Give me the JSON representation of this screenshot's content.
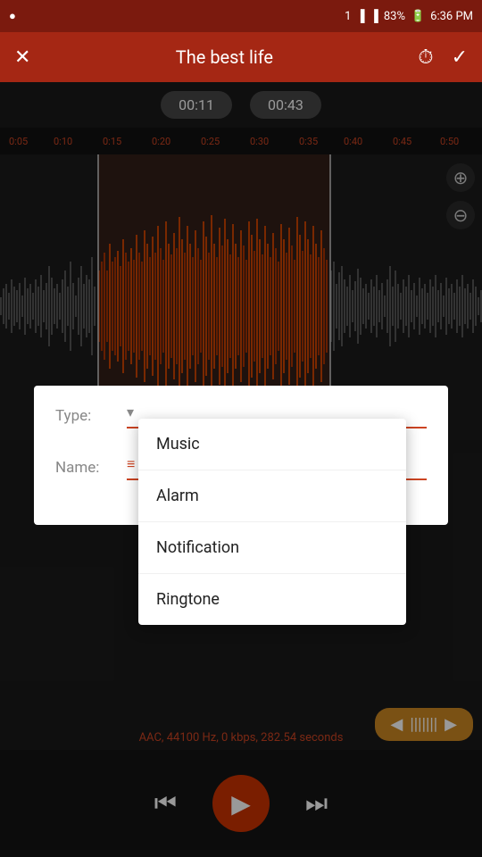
{
  "statusBar": {
    "leftIcon": "●",
    "simSlot": "1",
    "signalBars": "▂▄▆█",
    "signalBars2": "▂▄▆",
    "battery": "83%",
    "time": "6:36 PM"
  },
  "topBar": {
    "closeLabel": "✕",
    "title": "The best life",
    "historyLabel": "⏱",
    "checkLabel": "✓"
  },
  "timestamps": {
    "start": "00:11",
    "end": "00:43"
  },
  "timeMarkers": [
    "0:05",
    "0:10",
    "0:15",
    "0:20",
    "0:25",
    "0:30",
    "0:35",
    "0:40",
    "0:45",
    "0:50"
  ],
  "zoomIn": "⊕",
  "zoomOut": "⊖",
  "infoBar": "AAC, 44100 Hz, 0 kbps, 282.54 seconds",
  "transport": {
    "rewindLabel": "⏮",
    "playLabel": "▶",
    "forwardLabel": "⏭"
  },
  "form": {
    "typeLabel": "Type:",
    "nameLabel": "Name:"
  },
  "dropdown": {
    "items": [
      "Music",
      "Alarm",
      "Notification",
      "Ringtone"
    ]
  }
}
